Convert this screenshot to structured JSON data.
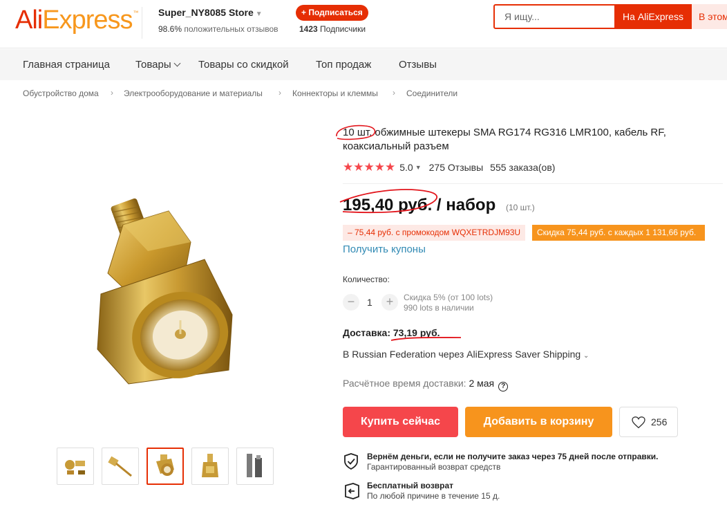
{
  "header": {
    "logo_ali": "Ali",
    "logo_express": "Express",
    "store_name": "Super_NY8085 Store",
    "store_rating_pct": "98.6%",
    "store_rating_text": "положительных отзывов",
    "subscribe_label": "+ Подписаться",
    "subscribers_count": "1423",
    "subscribers_label": "Подписчики",
    "search_placeholder": "Я ищу...",
    "search_aliexpress": "На AliExpress",
    "search_store": "В этом"
  },
  "nav": {
    "items": [
      "Главная страница",
      "Товары",
      "Товары со скидкой",
      "Топ продаж",
      "Отзывы"
    ]
  },
  "breadcrumb": [
    "Обустройство дома",
    "Электрооборудование и материалы",
    "Коннекторы и клеммы",
    "Соединители"
  ],
  "product": {
    "title": "10 шт. обжимные штекеры SMA RG174 RG316 LMR100, кабель RF, коаксиальный разъем",
    "stars": 5,
    "rating": "5.0",
    "reviews": "275 Отзывы",
    "orders": "555 заказа(ов)",
    "price": "195,40 руб. / набор",
    "price_unit": "(10 шт.)",
    "promo": "– 75,44 руб. с промокодом WQXETRDJM93U",
    "discount": "Скидка 75,44 руб. с каждых 1 131,66 руб.",
    "coupons": "Получить купоны",
    "quantity_label": "Количество:",
    "quantity_value": "1",
    "qty_minus": "−",
    "qty_plus": "+",
    "quantity_discount": "Скидка 5% (от 100 lots)",
    "stock": "990 lots в наличии",
    "shipping_label": "Доставка: 73,19 руб.",
    "shipping_via": "В Russian Federation через AliExpress Saver Shipping",
    "delivery_label": "Расчётное время доставки:",
    "delivery_date": "2 мая",
    "buy_now": "Купить сейчас",
    "add_to_cart": "Добавить в корзину",
    "wishlist_count": "256"
  },
  "guarantees": [
    {
      "title": "Вернём деньги, если не получите заказ через 75 дней после отправки.",
      "subtitle": "Гарантированный возврат средств",
      "icon": "shield-check-icon"
    },
    {
      "title": "Бесплатный возврат",
      "subtitle": "По любой причине в течение 15 д.",
      "icon": "return-box-icon"
    }
  ],
  "colors": {
    "brand_red": "#e62e04",
    "brand_orange": "#f7971d",
    "buy_red": "#f5464b",
    "cart_orange": "#f7941d",
    "link_blue": "#318ab4"
  }
}
